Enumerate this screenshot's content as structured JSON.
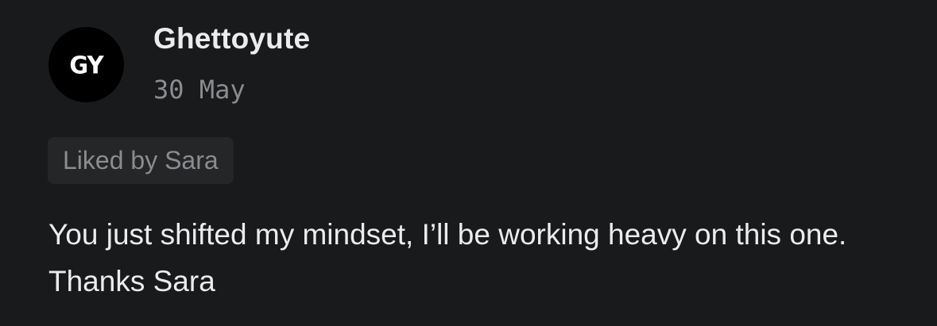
{
  "comment": {
    "avatar_initials": "GY",
    "username": "Ghettoyute",
    "date": "30 May",
    "liked_label": "Liked by Sara",
    "text": "You just shifted my mindset, I’ll be working heavy on this one. Thanks Sara"
  },
  "colors": {
    "background": "#181a1c",
    "avatar_bg": "#000000",
    "primary_text": "#ececec",
    "secondary_text": "#8a8c8f",
    "badge_bg": "#242628"
  }
}
